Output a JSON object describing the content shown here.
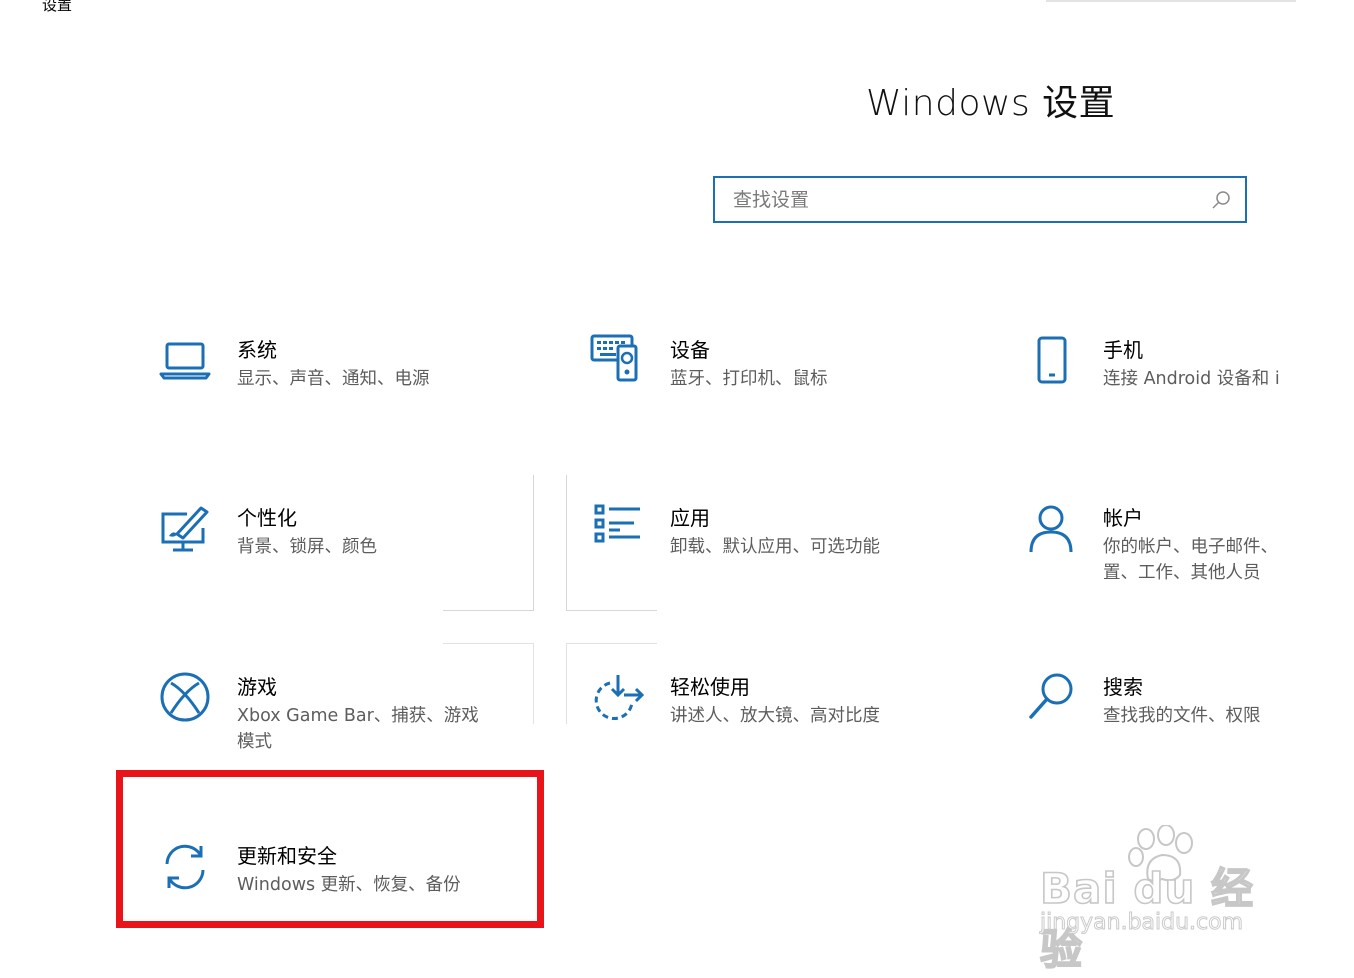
{
  "window": {
    "title": "设置"
  },
  "header": {
    "title": "Windows 设置"
  },
  "search": {
    "placeholder": "查找设置"
  },
  "colors": {
    "accent": "#1a6fb5",
    "highlight": "#e8141a"
  },
  "tiles": [
    {
      "title": "系统",
      "subtitle": "显示、声音、通知、电源",
      "icon": "laptop-icon"
    },
    {
      "title": "设备",
      "subtitle": "蓝牙、打印机、鼠标",
      "icon": "devices-icon"
    },
    {
      "title": "手机",
      "subtitle": "连接 Android 设备和 i",
      "icon": "phone-icon"
    },
    {
      "title": "个性化",
      "subtitle": "背景、锁屏、颜色",
      "icon": "personalization-icon"
    },
    {
      "title": "应用",
      "subtitle": "卸载、默认应用、可选功能",
      "icon": "apps-icon"
    },
    {
      "title": "帐户",
      "subtitle": "你的帐户、电子邮件、\n置、工作、其他人员",
      "icon": "person-icon"
    },
    {
      "title": "游戏",
      "subtitle": "Xbox Game Bar、捕获、游戏\n模式",
      "icon": "xbox-icon"
    },
    {
      "title": "轻松使用",
      "subtitle": "讲述人、放大镜、高对比度",
      "icon": "ease-of-access-icon"
    },
    {
      "title": "搜索",
      "subtitle": "查找我的文件、权限",
      "icon": "search-magnifier-icon"
    },
    {
      "title": "更新和安全",
      "subtitle": "Windows 更新、恢复、备份",
      "icon": "sync-icon"
    }
  ],
  "watermark": {
    "brand": "Bai du 经验",
    "url": "jingyan.baidu.com"
  }
}
